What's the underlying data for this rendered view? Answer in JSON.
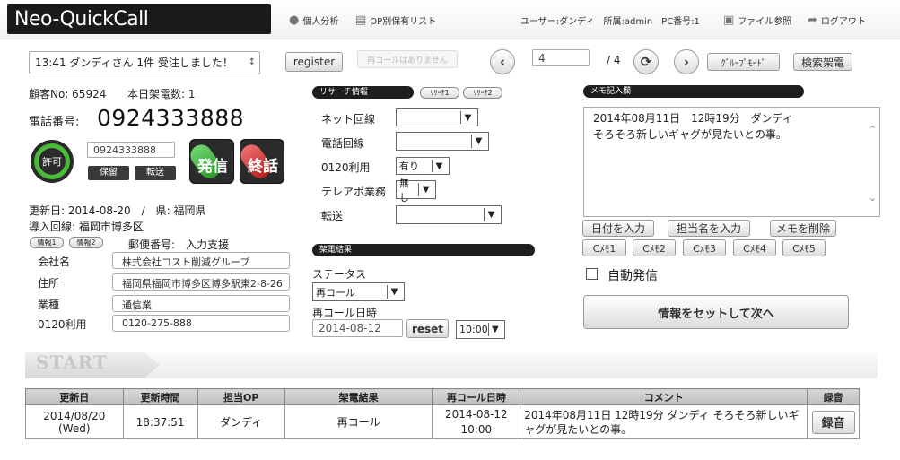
{
  "header": {
    "logo": "Neo-QuickCall",
    "nav": {
      "personal_analysis": "個人分析",
      "op_list": "OP別保有リスト",
      "user_info": "ユーザー:ダンディ　所属:admin　PC番号:1",
      "file_ref": "ファイル参照",
      "logout": "ログアウト"
    }
  },
  "toolbar": {
    "notification": "13:41 ダンディさん 1件 受注しました！",
    "register_label": "register",
    "recall_none": "再コールはありません",
    "page_current": "4",
    "page_total": "/ 4",
    "group_mode": "ｸﾞﾙｰﾌﾟﾓｰﾄﾞ",
    "search_call": "検索架電"
  },
  "customer": {
    "customer_no": "顧客No: 65924",
    "today_calls": "本日架電数: 1",
    "phone_label": "電話番号:",
    "phone": "0924333888",
    "allow_label": "許可",
    "phone_small": "0924333888",
    "hold_label": "保留",
    "transfer_label": "転送",
    "call_label": "発信",
    "end_label": "終話",
    "updated": "更新日: 2014-08-20　/　県: 福岡県",
    "line": "導入回線: 福岡市博多区",
    "info1": "情報1",
    "info2": "情報2",
    "postal": "郵便番号:　入力支援",
    "fields": [
      {
        "label": "会社名",
        "value": "株式会社コスト削減グループ"
      },
      {
        "label": "住所",
        "value": "福岡県福岡市博多区博多駅東2-8-26"
      },
      {
        "label": "業種",
        "value": "通信業"
      },
      {
        "label": "0120利用",
        "value": "0120-275-888"
      }
    ]
  },
  "research": {
    "title": "リサーチ情報",
    "tab1": "ﾘｻｰﾁ1",
    "tab2": "ﾘｻｰﾁ2",
    "rows": [
      {
        "label": "ネット回線",
        "value": ""
      },
      {
        "label": "電話回線",
        "value": ""
      },
      {
        "label": "0120利用",
        "value": "有り"
      },
      {
        "label": "テレアポ業務",
        "value": "無し"
      },
      {
        "label": "転送",
        "value": ""
      }
    ]
  },
  "result": {
    "title": "架電結果",
    "status_label": "ステータス",
    "status_value": "再コール",
    "recall_label": "再コール日時",
    "recall_date": "2014-08-12",
    "reset_label": "reset",
    "recall_time": "10:00"
  },
  "memo": {
    "title": "メモ記入欄",
    "line1": "2014年08月11日　12時19分　ダンディ",
    "line2": "そろそろ新しいギャグが見たいとの事。",
    "date_btn": "日付を入力",
    "owner_btn": "担当名を入力",
    "delete_btn": "メモを削除",
    "templates": [
      "Cﾒﾓ1",
      "Cﾒﾓ2",
      "Cﾒﾓ3",
      "Cﾒﾓ4",
      "Cﾒﾓ5"
    ],
    "auto_dial": "自動発信",
    "next_btn": "情報をセットして次へ"
  },
  "start_label": "START",
  "history": {
    "headers": [
      "更新日",
      "更新時間",
      "担当OP",
      "架電結果",
      "再コール日時",
      "コメント",
      "録音"
    ],
    "rows": [
      {
        "date": "2014/08/20 (Wed)",
        "time": "18:37:51",
        "op": "ダンディ",
        "result": "再コール",
        "recall_date": "2014-08-12",
        "recall_time": "10:00",
        "comment": "2014年08月11日 12時19分 ダンディ そろそろ新しいギャグが見たいとの事。",
        "record_btn": "録音"
      }
    ]
  },
  "colors": {
    "call_green": "#3aa53a",
    "end_red": "#cc2a2a",
    "allow_green": "#4cc23a",
    "dark_button": "#3a3a3a"
  }
}
